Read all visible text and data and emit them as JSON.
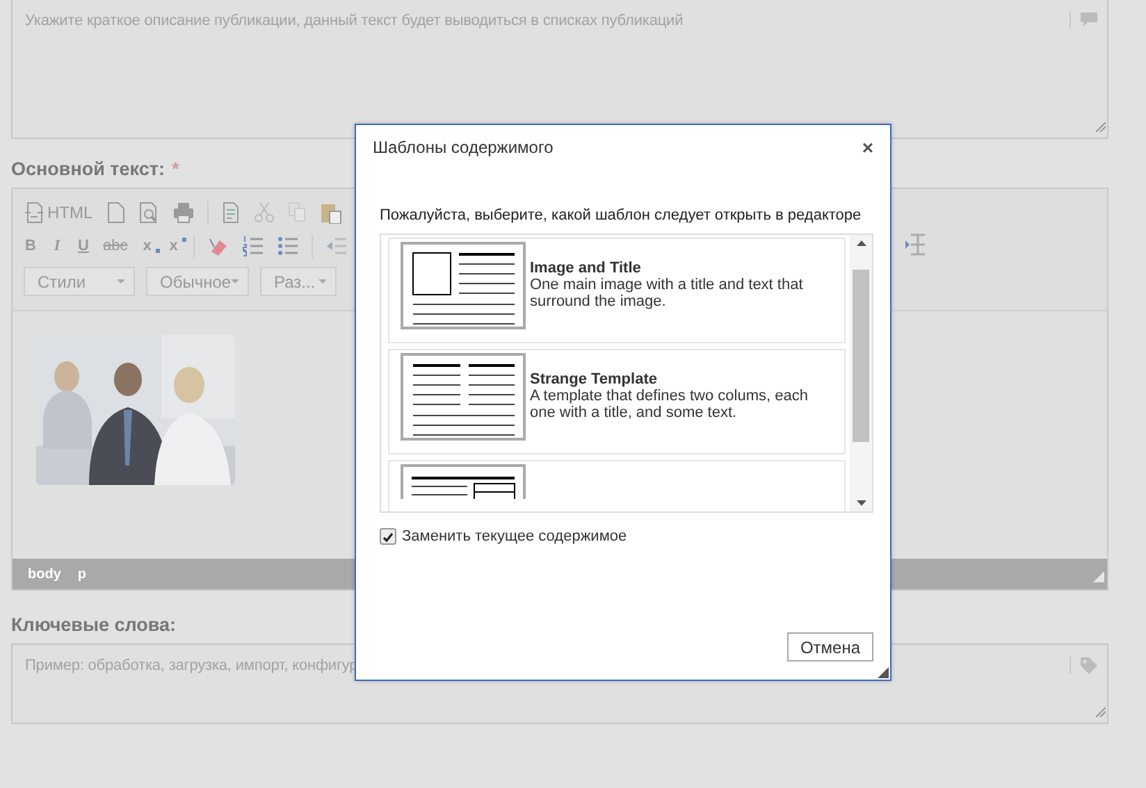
{
  "summary_field": {
    "placeholder": "Укажите краткое описание публикации, данный текст будет выводиться в списках публикаций"
  },
  "main_text": {
    "label": "Основной текст:",
    "required_mark": "*",
    "toolbar_rows": [
      [
        {
          "kind": "source",
          "text": "HTML"
        },
        {
          "kind": "newpage"
        },
        {
          "kind": "preview"
        },
        {
          "kind": "print"
        },
        {
          "kind": "sep"
        },
        {
          "kind": "templates"
        },
        {
          "kind": "cut"
        },
        {
          "kind": "copy"
        },
        {
          "kind": "paste"
        }
      ],
      [
        {
          "kind": "bold",
          "text": "B"
        },
        {
          "kind": "italic",
          "text": "I"
        },
        {
          "kind": "underline",
          "text": "U"
        },
        {
          "kind": "strike",
          "text": "abc"
        },
        {
          "kind": "subscript",
          "text": "x"
        },
        {
          "kind": "superscript",
          "text": "x"
        },
        {
          "kind": "sep"
        },
        {
          "kind": "removeformat"
        },
        {
          "kind": "numlist"
        },
        {
          "kind": "bullist"
        },
        {
          "kind": "sep"
        },
        {
          "kind": "outdent"
        }
      ]
    ],
    "right_tools": [
      {
        "kind": "hline"
      }
    ],
    "combos": [
      {
        "label": "Стили"
      },
      {
        "label": "Обычное"
      },
      {
        "label": "Раз..."
      }
    ],
    "content": {
      "kind": "picture"
    },
    "path": [
      "body",
      "p"
    ]
  },
  "keywords": {
    "label": "Ключевые слова:",
    "placeholder": "Пример: обработка, загрузка, импорт, конфигур"
  },
  "dialog": {
    "title": "Шаблоны содержимого",
    "close": "×",
    "instruction": "Пожалуйста, выберите, какой шаблон следует открыть в редакторе",
    "templates": [
      {
        "kind": "image-title",
        "title": "Image and Title",
        "description": "One main image with a title and text that surround the image."
      },
      {
        "kind": "two-columns",
        "title": "Strange Template",
        "description": "A template that defines two colums, each one with a title, and some text."
      },
      {
        "kind": "text-table"
      }
    ],
    "replace": {
      "label": "Заменить текущее содержимое",
      "checked": true
    },
    "cancel": "Отмена"
  }
}
